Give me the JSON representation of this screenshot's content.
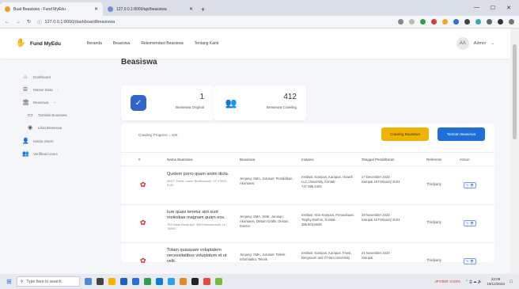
{
  "browser": {
    "tabs": [
      {
        "label": "Buat Beasiswa - Fund MyEdu"
      },
      {
        "label": "127.0.0.1:8000/api/beasiswa"
      }
    ],
    "new_tab": "+",
    "url": "127.0.0.1:8000/dashboard/beasiswa"
  },
  "topnav": {
    "brand": "Fund MyEdu",
    "links": [
      "Beranda",
      "Beasiswa",
      "Rekomendasi Beasiswa",
      "Tentang Kami"
    ],
    "avatar_initials": "AA",
    "user_name": "Admin"
  },
  "sidebar": {
    "items": [
      {
        "label": "Dashboard",
        "icon": "home-icon"
      },
      {
        "label": "Master Data",
        "icon": "list-icon"
      },
      {
        "label": "Beasiswa",
        "icon": "bank-icon"
      },
      {
        "label": "Tambah Beasiswa",
        "icon": "add-icon"
      },
      {
        "label": "Lihat Beasiswa",
        "icon": "eye-icon"
      },
      {
        "label": "Kelola Users",
        "icon": "user-icon"
      },
      {
        "label": "Verifikasi Users",
        "icon": "users-icon"
      }
    ]
  },
  "page": {
    "title": "Beasiswa"
  },
  "cards": [
    {
      "value": "1",
      "label": "Beasiswa Original",
      "color": "#2f66c7"
    },
    {
      "value": "412",
      "label": "Beasiswa Crawling",
      "color": "#2f66c7"
    }
  ],
  "panel": {
    "crawl_label": "Crawling Progress = 100",
    "crawl_button": "Crawling Beasiswa",
    "add_button": "Tambah Beasiswa",
    "headers": [
      "#",
      "Nama Beasiswa",
      "Beasiswa",
      "Instansi",
      "Tanggal Pendaftaran",
      "Referensi",
      "Action"
    ],
    "rows": [
      {
        "title": "Quidem porro quam animi dicta.",
        "address": "66927 Feest Corner Breitenworth, VT 97003-0140",
        "beasiswa": "Jenjang: SMA, Jurusan: Pendidikan, Akuntansi",
        "instansi": "Institusi: Kampus, Kampus: Howell LLC University, Kontak: 747.086.4302",
        "tanggal_start": "17 December 2023",
        "tanggal_end": "Sampai 19 February 2024",
        "ref": "Thirdparty"
      },
      {
        "title": "Iure quasi tenetur sint sunt molestiae magnam quam eos.",
        "address": "753 Maria Ramp Apt. 359 Robertsmouth, HI 78263",
        "beasiswa": "Jenjang: SMA, SMK, Jurusan: Akuntansi, Desain Grafis, Desain Interior",
        "instansi": "Institusi: Non-Kampus, Perusahaan: Torphy-Boehm, Kontak: 386.803.6638",
        "tanggal_start": "29 November 2023",
        "tanggal_end": "Sampai 15 February 2024",
        "ref": "Thirdparty"
      },
      {
        "title": "Totam quisquam voluptatem necessitatibus voluptatum et ut velit.",
        "address": "",
        "beasiswa": "Jenjang: SMK, Jurusan: Teknik Informatika, Teknik",
        "instansi": "Institusi: Kampus, Kampus: Feest, Bergnaum and O'Hara University",
        "tanggal_start": "21 November 2023",
        "tanggal_end": "Sampai",
        "ref": "Thirdparty"
      }
    ]
  },
  "taskbar": {
    "search_placeholder": "Type here to search",
    "currency": "JPY/IDR -0.83%",
    "time": "22:08",
    "date": "19/12/2023"
  }
}
